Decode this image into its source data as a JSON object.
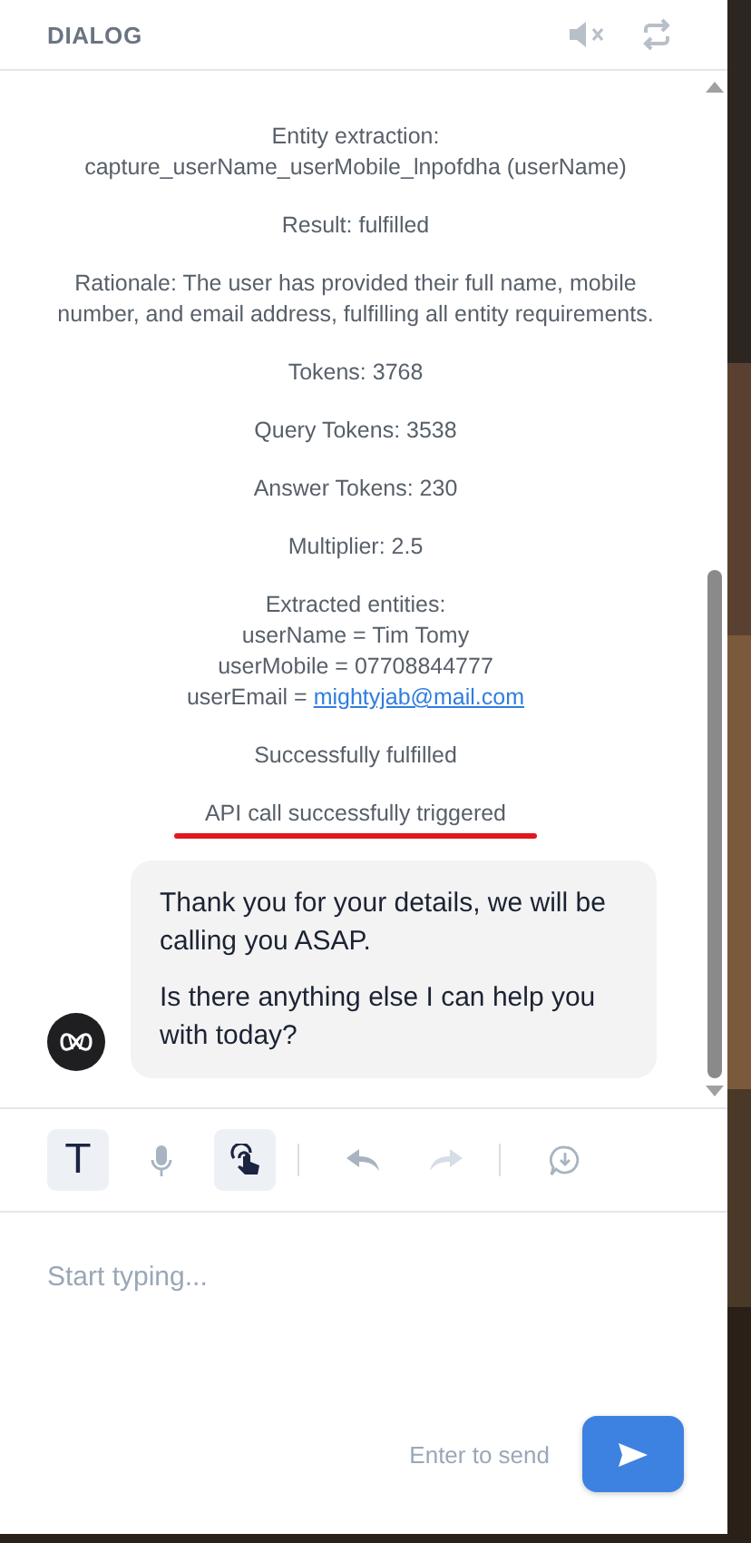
{
  "header": {
    "title": "DIALOG"
  },
  "log": [
    {
      "lines": [
        {
          "text": "Entity extraction:"
        },
        {
          "text": "capture_userName_userMobile_lnpofdha (userName)"
        }
      ]
    },
    {
      "lines": [
        {
          "text": "Result: fulfilled"
        }
      ]
    },
    {
      "lines": [
        {
          "text": "Rationale: The user has provided their full name, mobile number, and email address, fulfilling all entity requirements."
        }
      ]
    },
    {
      "lines": [
        {
          "text": "Tokens: 3768"
        }
      ]
    },
    {
      "lines": [
        {
          "text": "Query Tokens: 3538"
        }
      ]
    },
    {
      "lines": [
        {
          "text": "Answer Tokens: 230"
        }
      ]
    },
    {
      "lines": [
        {
          "text": "Multiplier: 2.5"
        }
      ]
    },
    {
      "lines": [
        {
          "text": "Extracted entities:"
        },
        {
          "text": "userName = Tim Tomy"
        },
        {
          "text": "userMobile = 07708844777"
        },
        {
          "text": "userEmail = ",
          "link": "mightyjab@mail.com"
        }
      ]
    },
    {
      "lines": [
        {
          "text": "Successfully fulfilled"
        }
      ]
    },
    {
      "lines": [
        {
          "text": "API call successfully triggered"
        }
      ],
      "underlined": true
    }
  ],
  "message": {
    "paragraphs": [
      "Thank you for your details, we will be calling you ASAP.",
      "Is there anything else I can help you with today?"
    ]
  },
  "toolbar": [
    {
      "kind": "text",
      "label": "T",
      "selected": true,
      "disabled": false
    },
    {
      "kind": "mic",
      "selected": false,
      "disabled": false
    },
    {
      "kind": "touch",
      "selected": true,
      "disabled": false
    },
    {
      "kind": "divider"
    },
    {
      "kind": "undo",
      "selected": false,
      "disabled": false
    },
    {
      "kind": "redo",
      "selected": false,
      "disabled": true
    },
    {
      "kind": "divider"
    },
    {
      "kind": "download",
      "selected": false,
      "disabled": false
    }
  ],
  "composer": {
    "placeholder": "Start typing...",
    "hint": "Enter to send"
  }
}
